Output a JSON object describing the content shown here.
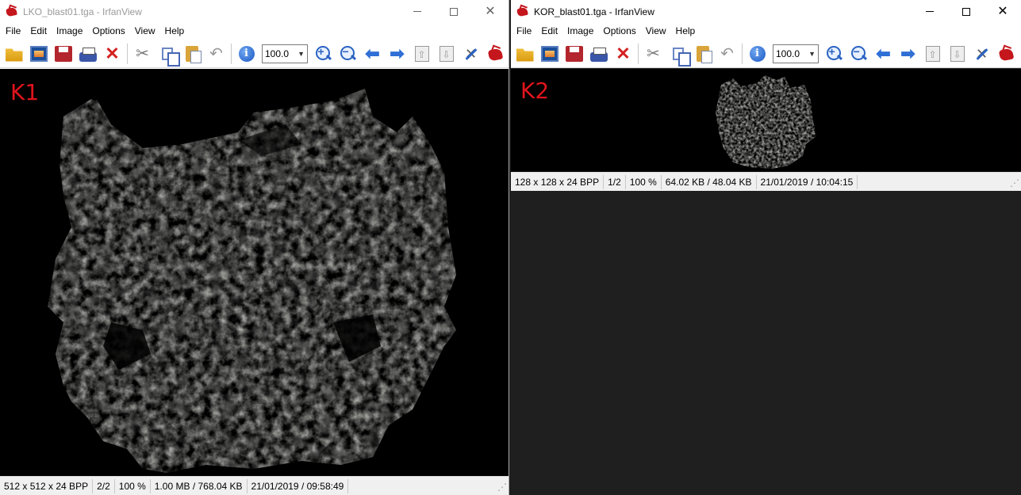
{
  "windows": [
    {
      "id": "left",
      "title": "LKO_blast01.tga - IrfanView",
      "menu": [
        "File",
        "Edit",
        "Image",
        "Options",
        "View",
        "Help"
      ],
      "zoom_value": "100.0",
      "image_label": "K1",
      "status": {
        "dimensions": "512 x 512 x 24 BPP",
        "index": "2/2",
        "zoom": "100 %",
        "size": "1.00 MB / 768.04 KB",
        "datetime": "21/01/2019 / 09:58:49"
      }
    },
    {
      "id": "right",
      "title": "KOR_blast01.tga - IrfanView",
      "menu": [
        "File",
        "Edit",
        "Image",
        "Options",
        "View",
        "Help"
      ],
      "zoom_value": "100.0",
      "image_label": "K2",
      "status": {
        "dimensions": "128 x 128 x 24 BPP",
        "index": "1/2",
        "zoom": "100 %",
        "size": "64.02 KB / 48.04 KB",
        "datetime": "21/01/2019 / 10:04:15"
      }
    }
  ],
  "toolbar_icons": [
    "open-icon",
    "thumbnails-icon",
    "save-icon",
    "print-icon",
    "delete-icon",
    "cut-icon",
    "copy-icon",
    "paste-icon",
    "undo-icon",
    "info-icon",
    "zoom-in-icon",
    "zoom-out-icon",
    "previous-icon",
    "next-icon",
    "first-page-icon",
    "last-page-icon",
    "settings-icon",
    "about-icon"
  ],
  "colors": {
    "label_red": "#e0141c",
    "background": "#000000",
    "empty_area": "#1f1f1f"
  }
}
